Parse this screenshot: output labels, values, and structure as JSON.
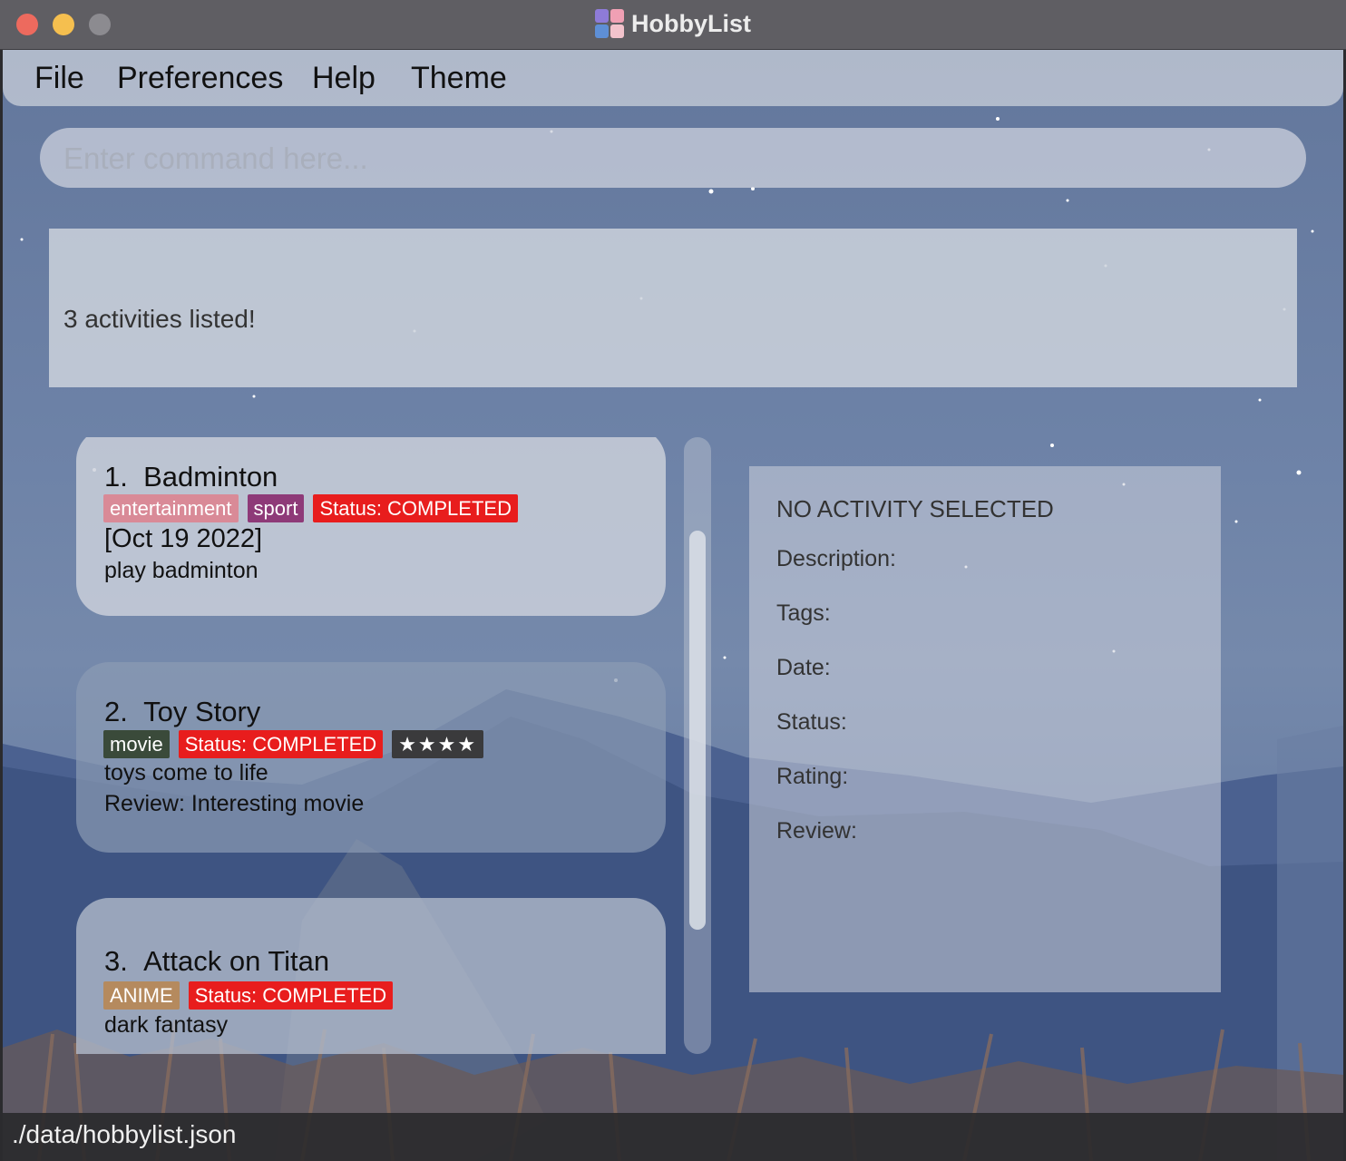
{
  "window": {
    "title": "HobbyList"
  },
  "menu": [
    "File",
    "Preferences",
    "Help",
    "Theme"
  ],
  "command": {
    "placeholder": "Enter command here...",
    "value": ""
  },
  "result": "3 activities listed!",
  "activities": [
    {
      "index": "1.",
      "name": "Badminton",
      "tags": [
        {
          "label": "entertainment",
          "color": "#d98a97"
        },
        {
          "label": "sport",
          "color": "#8e3a78"
        },
        {
          "label": "Status: COMPLETED",
          "color": "#e81d1d"
        }
      ],
      "date": "[Oct 19 2022]",
      "description": "play badminton"
    },
    {
      "index": "2.",
      "name": "Toy Story",
      "tags": [
        {
          "label": "movie",
          "color": "#3a4a3a"
        },
        {
          "label": "Status: COMPLETED",
          "color": "#e81d1d"
        },
        {
          "label": "★★★★",
          "color": "#3a3a3c"
        }
      ],
      "description": "toys come to life",
      "review": "Review: Interesting movie"
    },
    {
      "index": "3.",
      "name": "Attack on Titan",
      "tags": [
        {
          "label": "ANIME",
          "color": "#b58a5e"
        },
        {
          "label": "Status: COMPLETED",
          "color": "#e81d1d"
        }
      ],
      "description": "dark fantasy"
    }
  ],
  "details": {
    "heading": "NO ACTIVITY SELECTED",
    "labels": [
      "Description:",
      "Tags:",
      "Date:",
      "Status:",
      "Rating:",
      "Review:"
    ]
  },
  "status_bar": "./data/hobbylist.json"
}
